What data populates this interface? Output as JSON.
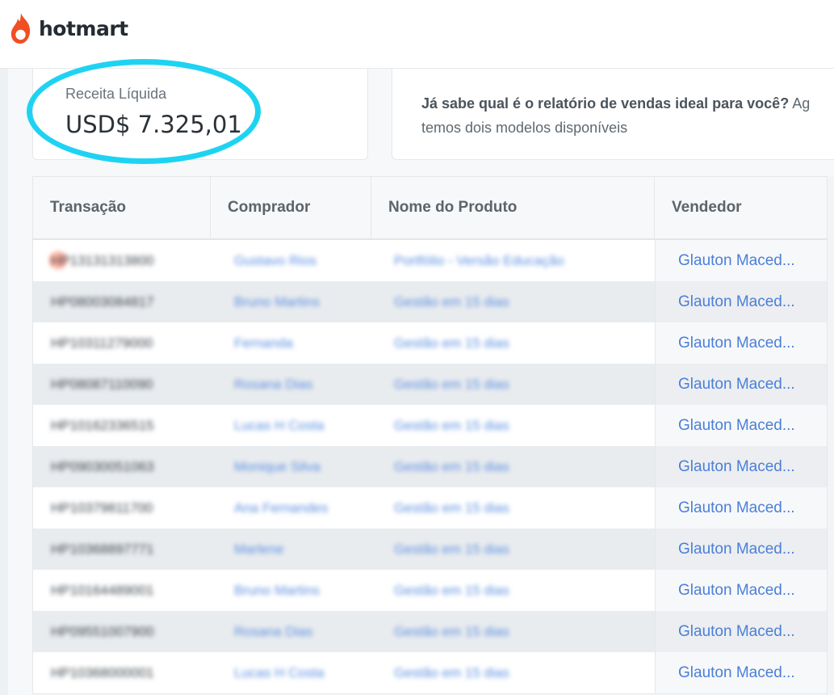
{
  "brand": {
    "name": "hotmart",
    "flame_color": "#f04e23"
  },
  "revenue": {
    "label": "Receita Líquida",
    "value": "USD$ 7.325,01",
    "highlight_color": "#1ed3f2"
  },
  "info": {
    "bold_text": "Já sabe qual é o relatório de vendas ideal para você?",
    "rest_text": " Ag",
    "line2": "temos dois modelos disponíveis"
  },
  "table": {
    "headers": [
      "Transação",
      "Comprador",
      "Nome do Produto",
      "Vendedor"
    ],
    "rows": [
      {
        "transaction": "HP13131313800",
        "buyer": "Gustavo Rios",
        "product": "Portfólio - Versão Educação",
        "seller": "Glauton Maced..."
      },
      {
        "transaction": "HP08003084817",
        "buyer": "Bruno Martins",
        "product": "Gestão em 15 dias",
        "seller": "Glauton Maced..."
      },
      {
        "transaction": "HP10311279000",
        "buyer": "Fernanda",
        "product": "Gestão em 15 dias",
        "seller": "Glauton Maced..."
      },
      {
        "transaction": "HP08087110090",
        "buyer": "Rosana Dias",
        "product": "Gestão em 15 dias",
        "seller": "Glauton Maced..."
      },
      {
        "transaction": "HP10162336515",
        "buyer": "Lucas H Costa",
        "product": "Gestão em 15 dias",
        "seller": "Glauton Maced..."
      },
      {
        "transaction": "HP09030051063",
        "buyer": "Monique Silva",
        "product": "Gestão em 15 dias",
        "seller": "Glauton Maced..."
      },
      {
        "transaction": "HP10379811700",
        "buyer": "Ana Fernandes",
        "product": "Gestão em 15 dias",
        "seller": "Glauton Maced..."
      },
      {
        "transaction": "HP10368897771",
        "buyer": "Marlene",
        "product": "Gestão em 15 dias",
        "seller": "Glauton Maced..."
      },
      {
        "transaction": "HP10164489001",
        "buyer": "Bruno Martins",
        "product": "Gestão em 15 dias",
        "seller": "Glauton Maced..."
      },
      {
        "transaction": "HP09551007900",
        "buyer": "Rosana Dias",
        "product": "Gestão em 15 dias",
        "seller": "Glauton Maced..."
      },
      {
        "transaction": "HP10368000001",
        "buyer": "Lucas H Costa",
        "product": "Gestão em 15 dias",
        "seller": "Glauton Maced..."
      }
    ]
  }
}
